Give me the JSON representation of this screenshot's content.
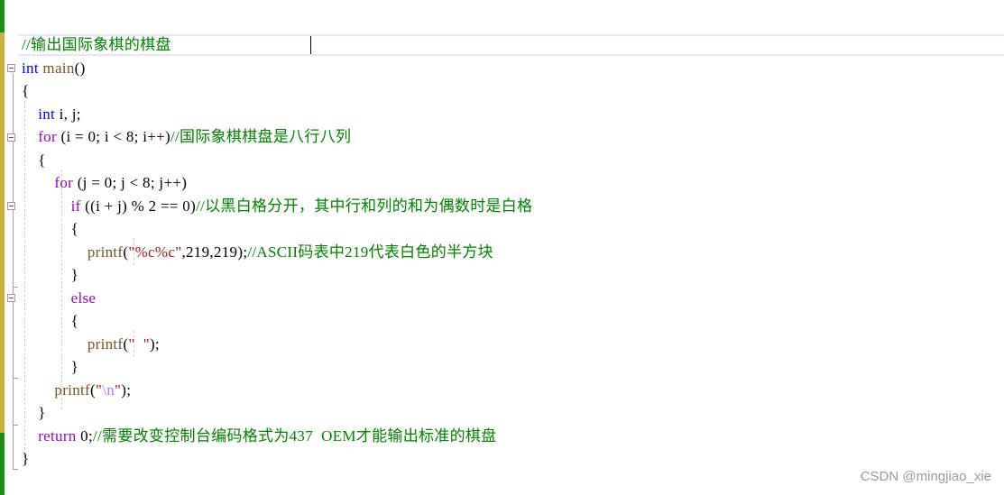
{
  "editor": {
    "lines": [
      {
        "segments": [
          {
            "t": "//输出国际象棋的棋盘",
            "c": "cm"
          }
        ]
      },
      {
        "segments": [
          {
            "t": "int",
            "c": "kw"
          },
          {
            "t": " "
          },
          {
            "t": "main",
            "c": "fn"
          },
          {
            "t": "()"
          }
        ]
      },
      {
        "segments": [
          {
            "t": "{"
          }
        ]
      },
      {
        "segments": [
          {
            "t": "    "
          },
          {
            "t": "int",
            "c": "kw"
          },
          {
            "t": " i, j;"
          }
        ]
      },
      {
        "segments": [
          {
            "t": "    "
          },
          {
            "t": "for",
            "c": "kw-ctl"
          },
          {
            "t": " (i = 0; i < 8; i++)"
          },
          {
            "t": "//国际象棋棋盘是八行八列",
            "c": "cm"
          }
        ]
      },
      {
        "segments": [
          {
            "t": "    {"
          }
        ]
      },
      {
        "segments": [
          {
            "t": "        "
          },
          {
            "t": "for",
            "c": "kw-ctl"
          },
          {
            "t": " (j = 0; j < 8; j++)"
          }
        ]
      },
      {
        "segments": [
          {
            "t": "            "
          },
          {
            "t": "if",
            "c": "kw-ctl"
          },
          {
            "t": " ((i + j) % 2 == 0)"
          },
          {
            "t": "//以黑白格分开，其中行和列的和为偶数时是白格",
            "c": "cm"
          }
        ]
      },
      {
        "segments": [
          {
            "t": "            {"
          }
        ]
      },
      {
        "segments": [
          {
            "t": "                "
          },
          {
            "t": "printf",
            "c": "fn"
          },
          {
            "t": "("
          },
          {
            "t": "\"%c%c\"",
            "c": "str"
          },
          {
            "t": ",219,219);"
          },
          {
            "t": "//ASCII码表中219代表白色的半方块",
            "c": "cm"
          }
        ]
      },
      {
        "segments": [
          {
            "t": "            }"
          }
        ]
      },
      {
        "segments": [
          {
            "t": "            "
          },
          {
            "t": "else",
            "c": "kw-ctl"
          }
        ]
      },
      {
        "segments": [
          {
            "t": "            {"
          }
        ]
      },
      {
        "segments": [
          {
            "t": "                "
          },
          {
            "t": "printf",
            "c": "fn"
          },
          {
            "t": "("
          },
          {
            "t": "\"  \"",
            "c": "str"
          },
          {
            "t": ");"
          }
        ]
      },
      {
        "segments": [
          {
            "t": "            }"
          }
        ]
      },
      {
        "segments": [
          {
            "t": "        "
          },
          {
            "t": "printf",
            "c": "fn"
          },
          {
            "t": "("
          },
          {
            "t": "\"",
            "c": "str"
          },
          {
            "t": "\\n",
            "c": "esc"
          },
          {
            "t": "\"",
            "c": "str"
          },
          {
            "t": ");"
          }
        ]
      },
      {
        "segments": [
          {
            "t": "    }"
          }
        ]
      },
      {
        "segments": [
          {
            "t": "    "
          },
          {
            "t": "return",
            "c": "kw-ctl"
          },
          {
            "t": " 0;"
          },
          {
            "t": "//需要改变控制台编码格式为437  OEM才能输出标准的棋盘",
            "c": "cm"
          }
        ]
      },
      {
        "segments": [
          {
            "t": "}"
          }
        ]
      }
    ]
  },
  "watermark": "CSDN @mingjiao_xie"
}
